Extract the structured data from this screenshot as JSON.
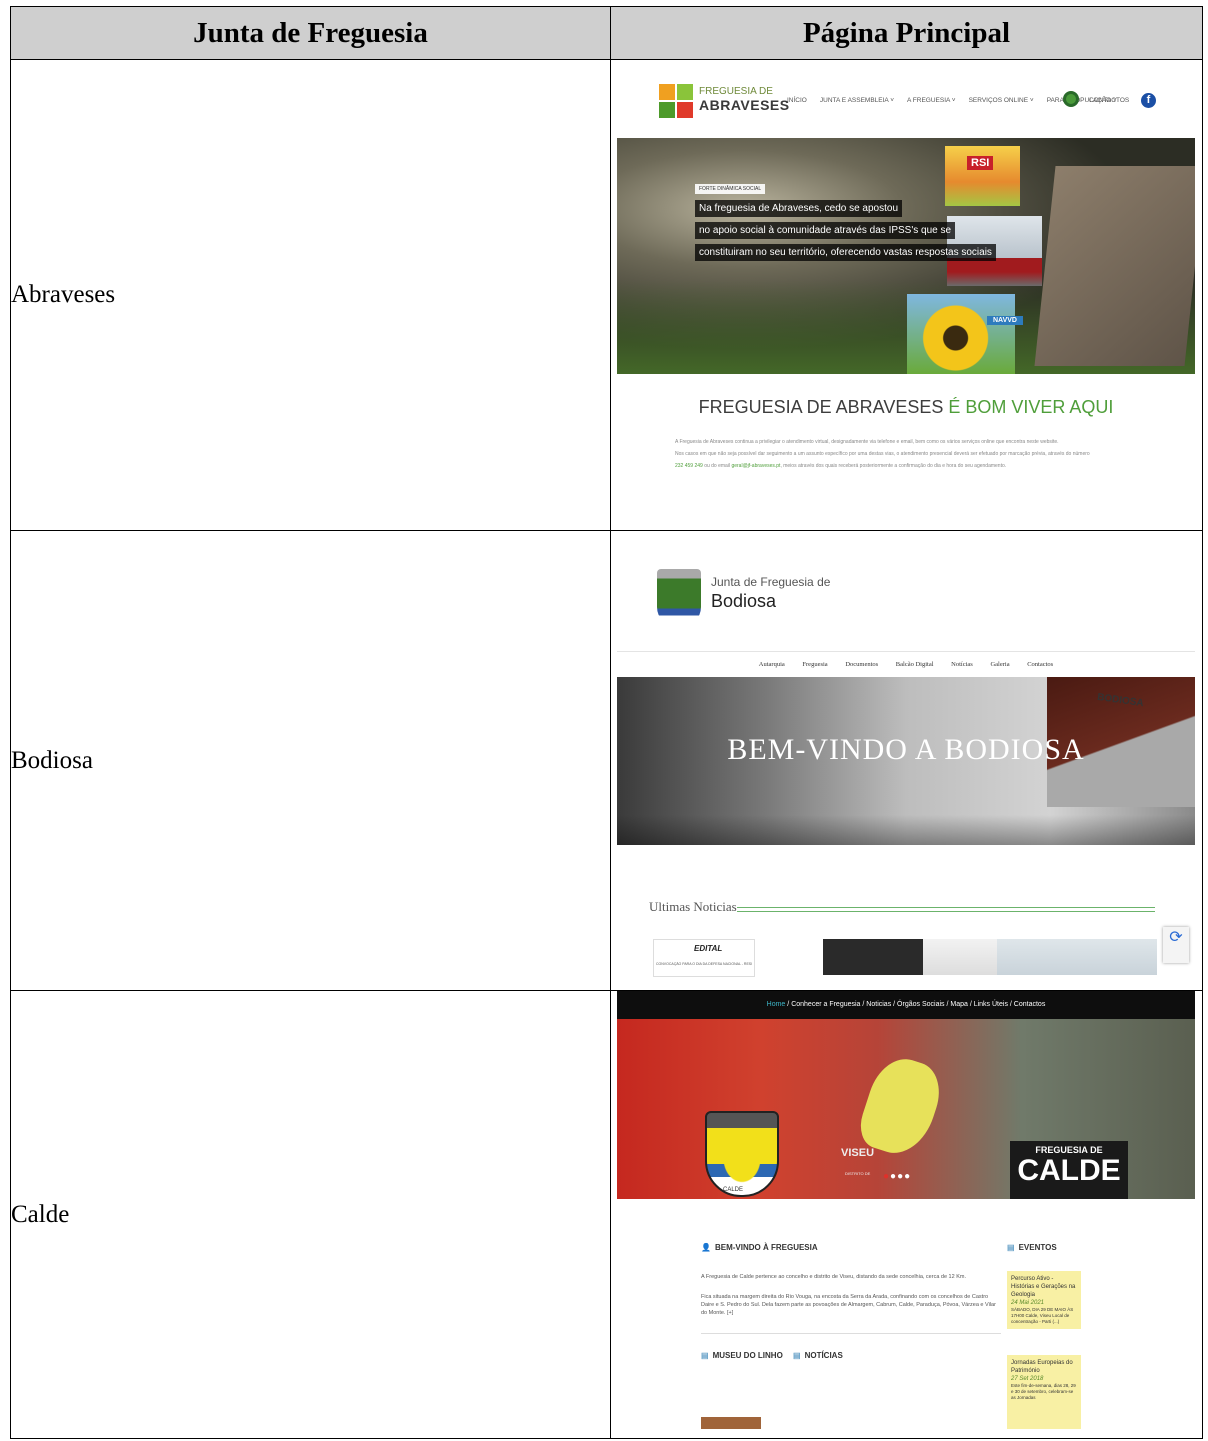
{
  "headers": {
    "col1": "Junta de Freguesia",
    "col2": "Página Principal"
  },
  "rows": [
    {
      "name": "Abraveses"
    },
    {
      "name": "Bodiosa"
    },
    {
      "name": "Calde"
    }
  ],
  "abraveses": {
    "logo_small": "FREGUESIA DE",
    "logo_big": "ABRAVESES",
    "menu": [
      "INÍCIO",
      "JUNTA E ASSEMBLEIA ˅",
      "A FREGUESIA ˅",
      "SERVIÇOS ONLINE ˅",
      "PARA A POPULAÇÃO ˅"
    ],
    "contact": "CONTACTOS",
    "fb": "f",
    "rsi": "RSI",
    "navvd": "NAVVD",
    "tag": "FORTE DINÂMICA SOCIAL",
    "caption": [
      "Na freguesia de Abraveses, cedo se apostou",
      "no apoio social à comunidade através das IPSS's que se",
      "constituiram no seu território, oferecendo vastas respostas sociais"
    ],
    "title_main": "FREGUESIA DE ABRAVESES ",
    "title_accent": "É BOM VIVER AQUI",
    "para1": "A Freguesia de Abraveses continua a privilegiar o atendimento virtual, designadamente via telefone e email, bem como os vários serviços online que encontra neste website.",
    "para2": "Nos casos em que não seja possível dar seguimento a um assunto específico por uma destas vias, o atendimento presencial deverá ser efetuado por marcação prévia, através do número",
    "phone": "232 459 249",
    "para3a": " ou do email ",
    "email": "geral@jf-abraveses.pt",
    "para3b": ", meios através dos quais receberá posteriormente a confirmação do dia e hora do seu agendamento."
  },
  "bodiosa": {
    "title_small": "Junta de Freguesia de",
    "title_big": "Bodiosa",
    "menu": [
      "Autarquia",
      "Freguesia",
      "Documentos",
      "Balcão Digital",
      "Notícias",
      "Galeria",
      "Contactos"
    ],
    "brand": "BODIOSA",
    "welcome": "BEM-VINDO A BODIOSA",
    "news": "Ultimas Noticias",
    "card1": "EDITAL",
    "card1_sub": "CONVOCAÇÃO PARA O DIA DA DEFESA NACIONAL - RESIDENTES EM PORTUGAL"
  },
  "calde": {
    "nav": [
      "Home",
      "Conhecer a Freguesia",
      "Noticias",
      "Órgãos Sociais",
      "Mapa",
      "Links Úteis",
      "Contactos"
    ],
    "viseu_small": "DISTRITO DE",
    "viseu": "VISEU",
    "crest_label": "CALDE",
    "brand_small": "FREGUESIA DE",
    "brand_big": "CALDE",
    "welcome_h": "BEM-VINDO À FREGUESIA",
    "events_h": "EVENTOS",
    "p1": "A Freguesia de Calde pertence ao concelho e distrito de Viseu, distando da sede concelhia, cerca de 12 Km.",
    "p2": "Fica situada na margem direita do Rio Vouga, na encosta da Serra da Arada, confinando com os concelhos de Castro Daire e S. Pedro do Sul. Dela fazem parte as povoações de Almargem, Cabrum, Calde, Paraduça, Póvoa, Várzea e Vilar do Monte. [+]",
    "museu_h": "MUSEU DO LINHO",
    "noticias_h": "NOTÍCIAS",
    "ev1_title": "Percurso Ativo - Histórias e Gerações na Geologia",
    "ev1_date": "24 Mai 2021",
    "ev1_text": "SÁBADO, DIA 29 DE MAIO ÀS 17H00 Calde, Viseu Local de concentração - Parti (...)",
    "ev2_title": "Jornadas Europeias do Património",
    "ev2_date": "27 Set 2018",
    "ev2_text": "Este fim-de-semana, dias 28, 29 e 30 de setembro, celebram-se as Jornadas"
  }
}
